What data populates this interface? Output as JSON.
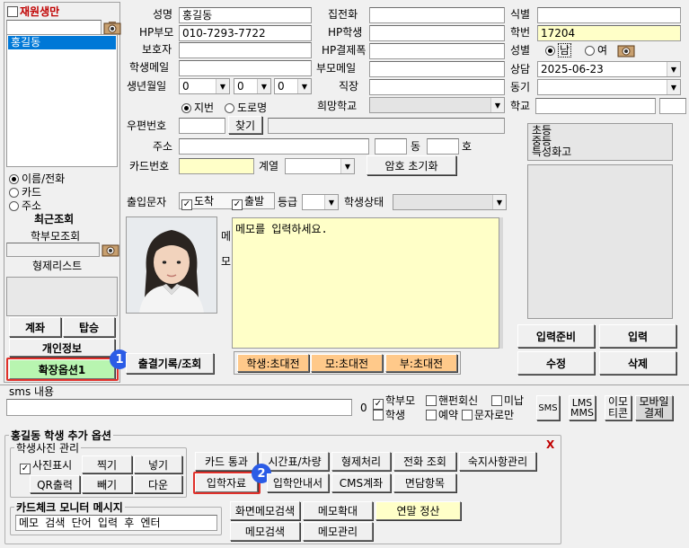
{
  "left": {
    "enrolled_label": "재원생만",
    "selected_student": "홍길동",
    "radios": [
      "이름/전화",
      "카드",
      "주소"
    ],
    "recent": "최근조회",
    "parent": "학부모조회",
    "siblings": "형제리스트",
    "btn_withdraw": "계좌",
    "btn_board": "탑승",
    "btn_personal": "개인정보",
    "btn_ext": "확장옵션1"
  },
  "form": {
    "name_label": "성명",
    "name": "홍길동",
    "hp_parent_label": "HP부모",
    "hp_parent": "010-7293-7722",
    "guardian_label": "보호자",
    "student_email_label": "학생메일",
    "birth_label": "생년월일",
    "birth": [
      "0",
      "0",
      "0"
    ],
    "home_phone_label": "집전화",
    "hp_student_label": "HP학생",
    "hp_title_label": "HP결제폭",
    "parent_email_label": "부모메일",
    "job_label": "직장",
    "school_wish_label": "희망학교",
    "id_label": "식별",
    "student_no_label": "학번",
    "student_no": "17204",
    "gender_label": "성별",
    "gender_m": "남",
    "gender_f": "여",
    "consult_label": "상담",
    "consult_date": "2025-06-23",
    "motive_label": "동기",
    "school_label": "학교",
    "addr_type": [
      "지번",
      "도로명"
    ],
    "zip_label": "우편번호",
    "find_btn": "찾기",
    "addr_label": "주소",
    "dong": "동",
    "ho": "호",
    "card_label": "카드번호",
    "track_label": "계열",
    "pw_reset": "암호 초기화",
    "out_sms_label": "출입문자",
    "arrive": "도착",
    "depart": "출발",
    "grade_label": "등급",
    "status_label": "학생상태",
    "memo_side": [
      "메",
      "모"
    ],
    "memo_placeholder": "메모를 입력하세요.",
    "grades": [
      "초등",
      "중등",
      "특성화고"
    ]
  },
  "buttons": {
    "attendance": "출결기록/조회",
    "invite_student": "학생:초대전",
    "invite_mother": "모:초대전",
    "invite_father": "부:초대전",
    "prepare": "입력준비",
    "input": "입력",
    "edit": "수정",
    "delete": "삭제"
  },
  "sms": {
    "label": "sms 내용",
    "count": "0",
    "parent": "학부모",
    "phone_reply": "핸펀회신",
    "unpaid": "미납",
    "student": "학생",
    "reserve": "예약",
    "text_only": "문자로만",
    "sms_btn": "SMS",
    "lms": [
      "LMS",
      "MMS"
    ],
    "emoji": [
      "이모",
      "티콘"
    ],
    "mobile": [
      "모바일",
      "결제"
    ]
  },
  "ext": {
    "title": "홍길동 학생 추가 옵션",
    "close": "X",
    "photo_group": "학생사진 관리",
    "photo_show": "사진표시",
    "shoot": "찍기",
    "insert": "넣기",
    "qr": "QR출력",
    "remove": "빼기",
    "download": "다운",
    "row1": [
      "카드 통과",
      "시간표/차량",
      "형제처리",
      "전화 조회",
      "숙지사항관리"
    ],
    "row2": [
      "입학자료",
      "입학안내서",
      "CMS계좌",
      "면담항목"
    ],
    "monitor_title": "카드체크 모니터 메시지",
    "monitor_text": "메모 검색 단어 입력 후 엔터",
    "row3": [
      "화면메모검색",
      "메모확대",
      "연말 정산"
    ],
    "row4": [
      "메모검색",
      "메모관리"
    ]
  },
  "badges": [
    "1",
    "2"
  ],
  "colors": {
    "accent": "#2b5ce6",
    "highlight": "#e0302a",
    "yellow": "#ffffc8",
    "orange": "#ffc98a",
    "green": "#b8f5b0",
    "list_sel": "#0078d7"
  }
}
